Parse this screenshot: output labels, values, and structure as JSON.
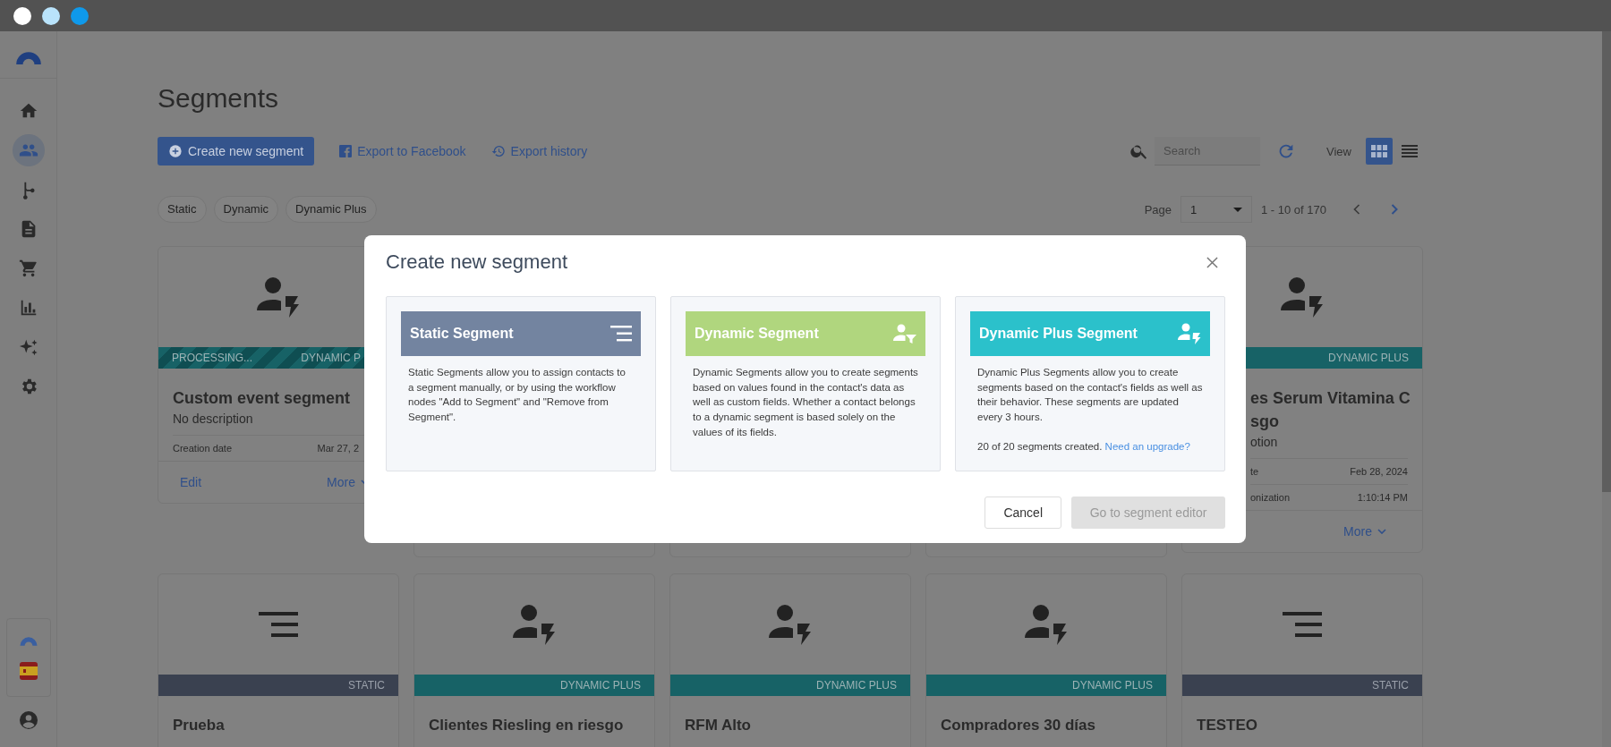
{
  "sidebar": {
    "items": [
      {
        "kind": "home",
        "selected": false
      },
      {
        "kind": "contacts",
        "selected": true
      },
      {
        "kind": "workflow",
        "selected": false
      },
      {
        "kind": "document",
        "selected": false
      },
      {
        "kind": "cart",
        "selected": false
      },
      {
        "kind": "chart",
        "selected": false
      },
      {
        "kind": "ai",
        "selected": false
      },
      {
        "kind": "settings",
        "selected": false
      }
    ]
  },
  "page": {
    "title": "Segments"
  },
  "toolbar": {
    "create": "Create new segment",
    "facebook": "Export to Facebook",
    "history": "Export history",
    "search": {
      "placeholder": "Search"
    },
    "view_label": "View",
    "views": [
      {
        "kind": "grid",
        "selected": true
      },
      {
        "kind": "list",
        "selected": false
      }
    ]
  },
  "filters": [
    "Static",
    "Dynamic",
    "Dynamic Plus"
  ],
  "pagination": {
    "label": "Page",
    "page": "1",
    "range": "1 - 10 of 170"
  },
  "cards_row_1": [
    {
      "kind": "dynamic_plus",
      "left_hidden": false,
      "status": "PROCESSING...",
      "band": "DYNAMIC P",
      "title": [
        "Custom event segment"
      ],
      "description": "No description",
      "rows": [
        {
          "label": "Creation date",
          "value": "Mar 27, 2"
        }
      ],
      "edit": "Edit",
      "more": "More"
    },
    {
      "kind": "covered"
    },
    {
      "kind": "covered"
    },
    {
      "kind": "covered"
    },
    {
      "kind": "dynamic_plus",
      "left_hidden": true,
      "band": "DYNAMIC PLUS",
      "title": [
        "es Serum Vitamina C",
        "sgo"
      ],
      "description": "otion",
      "rows": [
        {
          "label": "te",
          "value": "Feb 28, 2024"
        },
        {
          "label": "onization",
          "value": "1:10:14 PM"
        }
      ],
      "more": "More"
    }
  ],
  "cards_row_2": [
    {
      "kind": "static",
      "band": "STATIC",
      "title": "Prueba"
    },
    {
      "kind": "dynamic_plus",
      "band": "DYNAMIC PLUS",
      "title": "Clientes Riesling en riesgo"
    },
    {
      "kind": "dynamic_plus",
      "band": "DYNAMIC PLUS",
      "title": "RFM Alto"
    },
    {
      "kind": "dynamic_plus",
      "band": "DYNAMIC PLUS",
      "title": "Compradores 30 días"
    },
    {
      "kind": "static",
      "band": "STATIC",
      "title": "TESTEO"
    }
  ],
  "modal": {
    "title": "Create new segment",
    "options": [
      {
        "kind": "static",
        "color": "#7384a0",
        "title": "Static Segment",
        "description": "Static Segments allow you to assign contacts to a segment manually, or by using the workflow nodes \"Add to Segment\" and \"Remove from Segment\"."
      },
      {
        "kind": "dynamic",
        "color": "#b0d67e",
        "title": "Dynamic Segment",
        "description": "Dynamic Segments allow you to create segments based on values found in the contact's data as well as custom fields. Whether a contact belongs to a dynamic segment is based solely on the values of its fields."
      },
      {
        "kind": "dynamic_plus",
        "color": "#2bc1cb",
        "title": "Dynamic Plus Segment",
        "description": "Dynamic Plus Segments allow you to create segments based on the contact's fields as well as their behavior. These segments are updated every 3 hours.",
        "quota": "20 of 20 segments created.",
        "upgrade": "Need an upgrade?"
      }
    ],
    "cancel": "Cancel",
    "confirm": {
      "label": "Go to segment editor",
      "disabled": true
    }
  }
}
